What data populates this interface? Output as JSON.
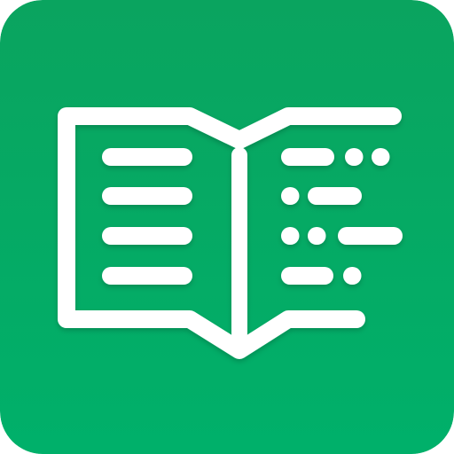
{
  "icon": {
    "name": "open-book-text-to-braille-icon",
    "colors": {
      "background_top": "#0aa45f",
      "background_bottom": "#00b06a",
      "foreground": "#ffffff"
    },
    "left_page_lines": 4,
    "right_page_rows": [
      [
        "dash",
        "dot",
        "dot"
      ],
      [
        "dot",
        "dash"
      ],
      [
        "dot",
        "dot",
        "dash"
      ],
      [
        "dash",
        "dot"
      ]
    ]
  }
}
